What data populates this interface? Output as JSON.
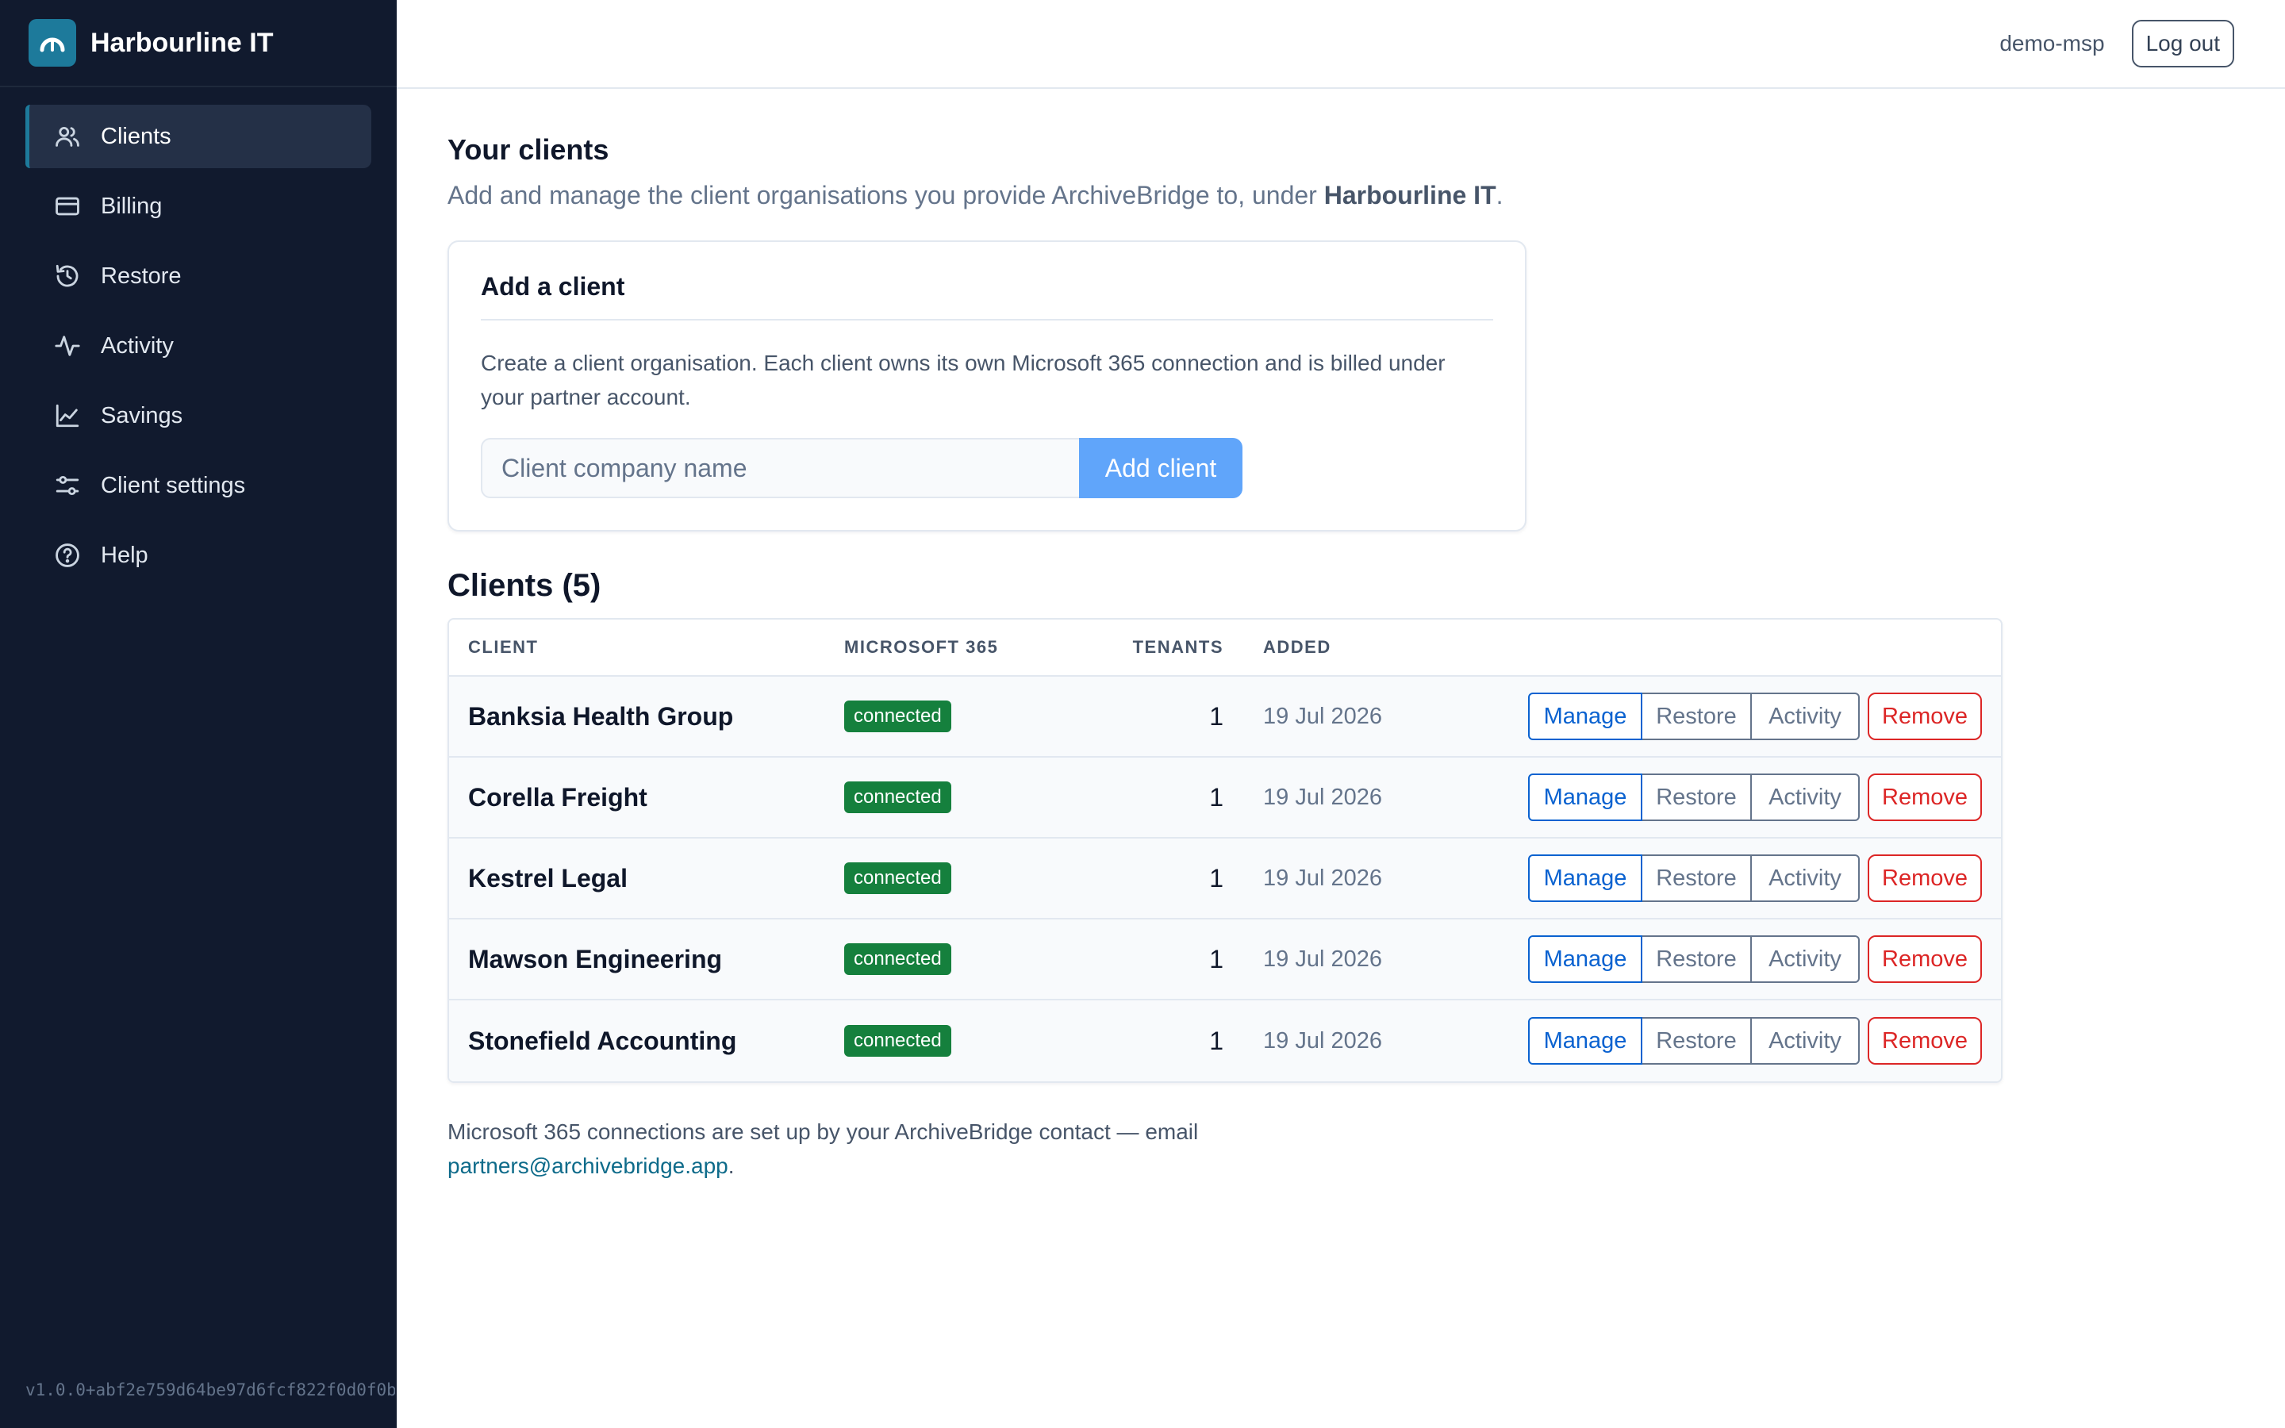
{
  "sidebar": {
    "brand": "Harbourline IT",
    "items": [
      {
        "label": "Clients",
        "icon": "users-icon",
        "active": true
      },
      {
        "label": "Billing",
        "icon": "credit-card-icon",
        "active": false
      },
      {
        "label": "Restore",
        "icon": "history-icon",
        "active": false
      },
      {
        "label": "Activity",
        "icon": "pulse-icon",
        "active": false
      },
      {
        "label": "Savings",
        "icon": "line-chart-icon",
        "active": false
      },
      {
        "label": "Client settings",
        "icon": "sliders-icon",
        "active": false
      },
      {
        "label": "Help",
        "icon": "help-circle-icon",
        "active": false
      }
    ],
    "version": "v1.0.0+abf2e759d64be97d6fcf822f0d0f0b"
  },
  "header": {
    "username": "demo-msp",
    "logout_label": "Log out"
  },
  "main": {
    "title": "Your clients",
    "subtitle_prefix": "Add and manage the client organisations you provide ArchiveBridge to, under ",
    "subtitle_org": "Harbourline IT",
    "subtitle_suffix": "."
  },
  "add_client": {
    "title": "Add a client",
    "description": "Create a client organisation. Each client owns its own Microsoft 365 connection and is billed under your partner account.",
    "placeholder": "Client company name",
    "value": "",
    "button_label": "Add client"
  },
  "clients": {
    "heading": "Clients (5)",
    "columns": [
      "CLIENT",
      "MICROSOFT 365",
      "TENANTS",
      "ADDED"
    ],
    "rows": [
      {
        "name": "Banksia Health Group",
        "status": "connected",
        "tenants": "1",
        "added": "19 Jul 2026"
      },
      {
        "name": "Corella Freight",
        "status": "connected",
        "tenants": "1",
        "added": "19 Jul 2026"
      },
      {
        "name": "Kestrel Legal",
        "status": "connected",
        "tenants": "1",
        "added": "19 Jul 2026"
      },
      {
        "name": "Mawson Engineering",
        "status": "connected",
        "tenants": "1",
        "added": "19 Jul 2026"
      },
      {
        "name": "Stonefield Accounting",
        "status": "connected",
        "tenants": "1",
        "added": "19 Jul 2026"
      }
    ],
    "actions": {
      "manage": "Manage",
      "restore": "Restore",
      "activity": "Activity",
      "remove": "Remove"
    }
  },
  "footer": {
    "note": "Microsoft 365 connections are set up by your ArchiveBridge contact — email",
    "email": "partners@archivebridge.app",
    "suffix": "."
  },
  "colors": {
    "sidebar_bg": "#111a2e",
    "brand_accent": "#1d7a9b",
    "primary_button": "#60a5fa",
    "connected_badge": "#15803d",
    "manage": "#0a62d0",
    "remove": "#dc2626",
    "link": "#0e6b8a"
  }
}
